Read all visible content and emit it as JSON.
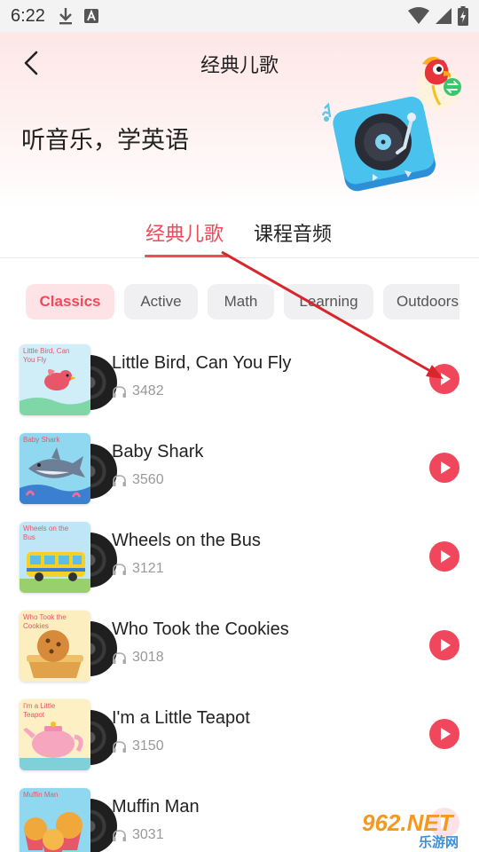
{
  "status_bar": {
    "time": "6:22"
  },
  "header": {
    "title": "经典儿歌",
    "slogan": "听音乐，学英语"
  },
  "tabs": [
    {
      "label": "经典儿歌",
      "active": true
    },
    {
      "label": "课程音频",
      "active": false
    }
  ],
  "categories": [
    {
      "label": "Classics",
      "active": true
    },
    {
      "label": "Active",
      "active": false
    },
    {
      "label": "Math",
      "active": false
    },
    {
      "label": "Learning",
      "active": false
    },
    {
      "label": "Outdoors",
      "active": false
    }
  ],
  "songs": [
    {
      "title": "Little Bird, Can You Fly",
      "plays": "3482",
      "cover_text": "Little Bird, Can You Fly",
      "cover_icon": "bird-icon"
    },
    {
      "title": "Baby Shark",
      "plays": "3560",
      "cover_text": "Baby Shark",
      "cover_icon": "shark-icon"
    },
    {
      "title": "Wheels on the Bus",
      "plays": "3121",
      "cover_text": "Wheels on the Bus",
      "cover_icon": "bus-icon"
    },
    {
      "title": "Who Took the Cookies",
      "plays": "3018",
      "cover_text": "Who Took the Cookies",
      "cover_icon": "cookie-icon"
    },
    {
      "title": "I'm a Little Teapot",
      "plays": "3150",
      "cover_text": "I'm a Little Teapot",
      "cover_icon": "teapot-icon"
    },
    {
      "title": "Muffin Man",
      "plays": "3031",
      "cover_text": "Muffin Man",
      "cover_icon": "muffin-icon"
    }
  ],
  "watermark": {
    "brand": "962.NET",
    "site": "乐游网"
  },
  "colors": {
    "accent": "#ef4a5a",
    "play": "#f0475c",
    "annotation": "#d8262c"
  }
}
